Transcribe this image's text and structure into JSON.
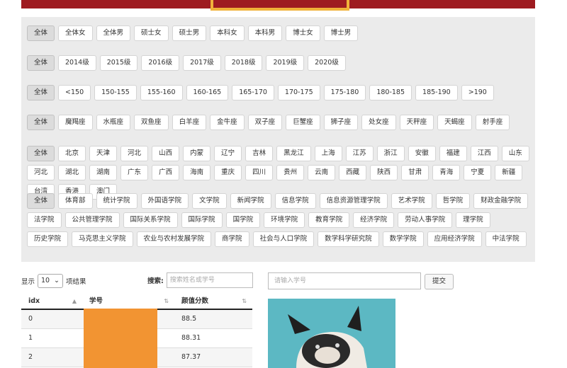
{
  "filters": {
    "rows": [
      {
        "name": "gender-degree",
        "items": [
          "全体",
          "全体女",
          "全体男",
          "硕士女",
          "硕士男",
          "本科女",
          "本科男",
          "博士女",
          "博士男"
        ]
      },
      {
        "name": "grade",
        "items": [
          "全体",
          "2014级",
          "2015级",
          "2016级",
          "2017级",
          "2018级",
          "2019级",
          "2020级"
        ]
      },
      {
        "name": "height",
        "items": [
          "全体",
          "<150",
          "150-155",
          "155-160",
          "160-165",
          "165-170",
          "170-175",
          "175-180",
          "180-185",
          "185-190",
          ">190"
        ]
      },
      {
        "name": "zodiac",
        "items": [
          "全体",
          "魔羯座",
          "水瓶座",
          "双鱼座",
          "白羊座",
          "金牛座",
          "双子座",
          "巨蟹座",
          "狮子座",
          "处女座",
          "天秤座",
          "天蝎座",
          "射手座"
        ]
      },
      {
        "name": "province",
        "items": [
          "全体",
          "北京",
          "天津",
          "河北",
          "山西",
          "内蒙",
          "辽宁",
          "吉林",
          "黑龙江",
          "上海",
          "江苏",
          "浙江",
          "安徽",
          "福建",
          "江西",
          "山东",
          "河北",
          "湖北",
          "湖南",
          "广东",
          "广西",
          "海南",
          "重庆",
          "四川",
          "贵州",
          "云南",
          "西藏",
          "陕西",
          "甘肃",
          "青海",
          "宁夏",
          "新疆",
          "台湾",
          "香港",
          "澳门"
        ]
      },
      {
        "name": "college",
        "items": [
          "全体",
          "体育部",
          "统计学院",
          "外国语学院",
          "文学院",
          "新闻学院",
          "信息学院",
          "信息资源管理学院",
          "艺术学院",
          "哲学院",
          "财政金融学院",
          "法学院",
          "公共管理学院",
          "国际关系学院",
          "国际学院",
          "国学院",
          "环境学院",
          "教育学院",
          "经济学院",
          "劳动人事学院",
          "理学院",
          "历史学院",
          "马克思主义学院",
          "农业与农村发展学院",
          "商学院",
          "社会与人口学院",
          "数学科学研究院",
          "数学学院",
          "应用经济学院",
          "中法学院"
        ]
      }
    ]
  },
  "table_controls": {
    "show_label": "显示",
    "page_length": "10",
    "results_label": "项结果",
    "search_label": "搜索:",
    "search_placeholder": "搜索姓名或学号"
  },
  "table": {
    "headers": [
      "idx",
      "学号",
      "颜值分数"
    ],
    "rows": [
      {
        "idx": "0",
        "score": "88.5"
      },
      {
        "idx": "1",
        "score": "88.31"
      },
      {
        "idx": "2",
        "score": "87.37"
      }
    ]
  },
  "lookup": {
    "placeholder": "请输入学号",
    "submit_label": "提交"
  },
  "colors": {
    "banner": "#9e1b20",
    "highlight": "#f0b23a",
    "redaction": "#f29432",
    "photo_bg": "#5cb8c3"
  }
}
